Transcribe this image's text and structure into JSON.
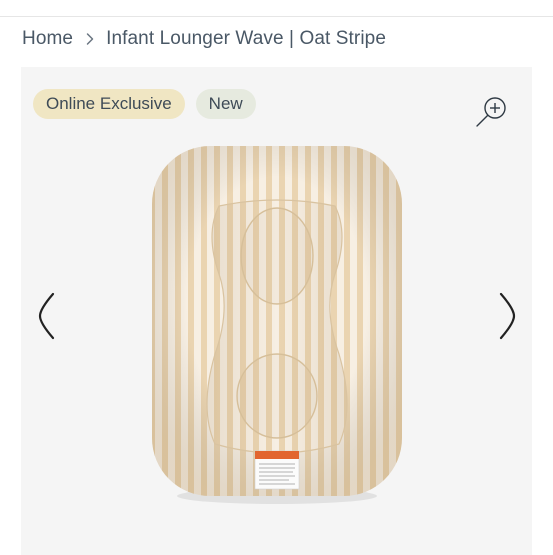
{
  "breadcrumb": {
    "home": "Home",
    "current": "Infant Lounger Wave | Oat Stripe"
  },
  "badges": {
    "exclusive": "Online Exclusive",
    "new": "New"
  },
  "icons": {
    "separator": "chevron-right-icon",
    "zoom": "zoom-in-icon",
    "prev": "chevron-left-icon",
    "next": "chevron-right-icon"
  },
  "colors": {
    "badge_exclusive_bg": "#f0e6c3",
    "badge_new_bg": "#e6eadf",
    "stripe": "#ead5b3",
    "base": "#f6eee1",
    "text": "#3b4a5a"
  }
}
